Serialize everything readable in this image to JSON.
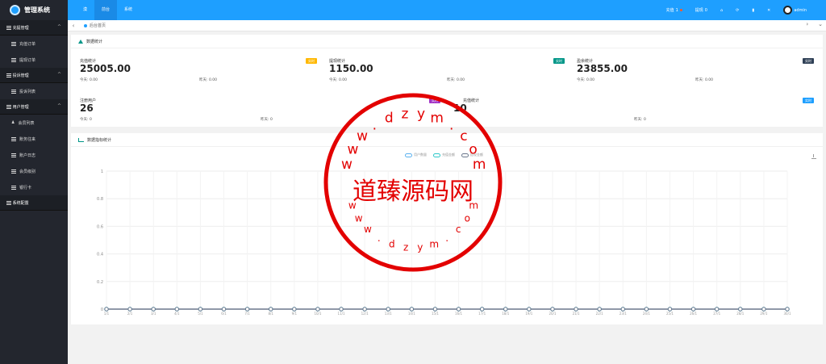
{
  "app": {
    "title": "管理系统"
  },
  "topnav": [
    {
      "label": "漠"
    },
    {
      "label": "前台"
    },
    {
      "label": "系统"
    }
  ],
  "topright": {
    "recharge": "充值",
    "recharge_count": "1",
    "withdraw": "提现",
    "withdraw_count": "0",
    "user": "admin"
  },
  "sidebar": {
    "groups": [
      {
        "label": "充提管理",
        "items": [
          {
            "label": "充值订单"
          },
          {
            "label": "提现订单"
          }
        ]
      },
      {
        "label": "投诉管理",
        "items": [
          {
            "label": "投诉列表"
          }
        ]
      },
      {
        "label": "用户管理",
        "items": [
          {
            "label": "会员列表"
          },
          {
            "label": "账务往来"
          },
          {
            "label": "账户日志"
          },
          {
            "label": "会员级别"
          },
          {
            "label": "银行卡"
          }
        ]
      },
      {
        "label": "系统配置",
        "items": []
      }
    ]
  },
  "tabs": {
    "home": "后台首页"
  },
  "stats_card": {
    "title": "数据统计"
  },
  "stats": [
    {
      "label": "充值统计",
      "value": "25005.00",
      "badge": "实时",
      "badge_color": "#ffb800",
      "today": "今天: 0.00",
      "yesterday": "昨天: 0.00"
    },
    {
      "label": "提现统计",
      "value": "1150.00",
      "badge": "实时",
      "badge_color": "#009688",
      "today": "今天: 0.00",
      "yesterday": "昨天: 0.00"
    },
    {
      "label": "盈余统计",
      "value": "23855.00",
      "badge": "实时",
      "badge_color": "#2f4056",
      "today": "今天: 0.00",
      "yesterday": "昨天: 0.00"
    },
    {
      "label": "注册用户",
      "value": "26",
      "badge": "实时",
      "badge_color": "#a233c6",
      "today": "今天: 0",
      "yesterday": "昨天: 0"
    },
    {
      "label": "充值统计",
      "value": "10",
      "badge": "实时",
      "badge_color": "#2f4056",
      "today": "今天: 0",
      "yesterday": "昨天: 0"
    },
    {
      "label": "",
      "value": "",
      "badge": "实时",
      "badge_color": "#1e9fff",
      "today": "今天: 0",
      "yesterday": "昨天: 0"
    }
  ],
  "chart_card": {
    "title": "数据指标统计"
  },
  "chart_data": {
    "type": "line",
    "categories": [
      "1/1",
      "2/1",
      "3/1",
      "4/1",
      "5/1",
      "6/1",
      "7/1",
      "8/1",
      "9/1",
      "10/1",
      "11/1",
      "12/1",
      "13/1",
      "14/1",
      "15/1",
      "16/1",
      "17/1",
      "18/1",
      "19/1",
      "20/1",
      "21/1",
      "22/1",
      "23/1",
      "24/1",
      "25/1",
      "26/1",
      "27/1",
      "28/1",
      "29/1",
      "30/1"
    ],
    "ylim": [
      0,
      1
    ],
    "yticks": [
      "0",
      "0.2",
      "0.4",
      "0.6",
      "0.8",
      "1"
    ],
    "series": [
      {
        "name": "用户数量",
        "color": "#5ab1ef",
        "values": [
          0,
          0,
          0,
          0,
          0,
          0,
          0,
          0,
          0,
          0,
          0,
          0,
          0,
          0,
          0,
          0,
          0,
          0,
          0,
          0,
          0,
          0,
          0,
          0,
          0,
          0,
          0,
          0,
          0,
          0
        ]
      },
      {
        "name": "充值金额",
        "color": "#2ec7c9",
        "values": [
          0,
          0,
          0,
          0,
          0,
          0,
          0,
          0,
          0,
          0,
          0,
          0,
          0,
          0,
          0,
          0,
          0,
          0,
          0,
          0,
          0,
          0,
          0,
          0,
          0,
          0,
          0,
          0,
          0,
          0
        ]
      },
      {
        "name": "提现金额",
        "color": "#6b778c",
        "values": [
          0,
          0,
          0,
          0,
          0,
          0,
          0,
          0,
          0,
          0,
          0,
          0,
          0,
          0,
          0,
          0,
          0,
          0,
          0,
          0,
          0,
          0,
          0,
          0,
          0,
          0,
          0,
          0,
          0,
          0
        ]
      }
    ]
  },
  "watermark": {
    "center_text": "道臻源码网",
    "ring_top": "www.dzym.com",
    "ring_bottom": "www.dzym.com"
  }
}
